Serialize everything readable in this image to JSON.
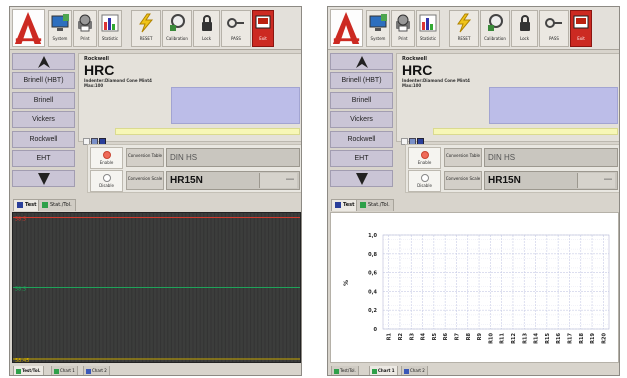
{
  "colors": {
    "toolbar_bg": "#e3e0da",
    "sidebar_button": "#cac5d6",
    "accent_red": "#cc2a22",
    "plot_dark_bg": "#3c3d3c",
    "limit_line": "#d23a2e",
    "target_line": "#1fa35a",
    "low_line": "#c9a800",
    "info_box": "#bcbde8",
    "info_strip": "#f7f7b6",
    "grid_line": "#c8cce6"
  },
  "toolbar": {
    "buttons": [
      {
        "label": "System",
        "icon": "monitor-icon"
      },
      {
        "label": "Print",
        "icon": "printer-icon"
      },
      {
        "label": "Statistic",
        "icon": "bar-chart-icon"
      },
      {
        "label": "RESET",
        "icon": "lightning-icon"
      },
      {
        "label": "Calibration",
        "icon": "calibration-icon"
      },
      {
        "label": "Lock",
        "icon": "lock-icon"
      },
      {
        "label": "PASS",
        "icon": "key-icon"
      },
      {
        "label": "Exit",
        "icon": "exit-icon"
      }
    ]
  },
  "sidebar": {
    "items": [
      "Brinell (HBT)",
      "Brinell",
      "Vickers",
      "Rockwell",
      "EHT"
    ]
  },
  "info": {
    "method": "Rockwell",
    "scale": "HRC",
    "details_line1": "Indenter:Diamond Cone Mint4",
    "details_line2": "Max:100"
  },
  "controls": {
    "enable_label": "Enable",
    "disable_label": "Disable",
    "conversion_table_label": "Conversion Table",
    "conversion_table_value": "DIN HS",
    "conversion_scale_label": "Conversion Scale",
    "conversion_scale_value": "HR15N",
    "dropdown_value": "----"
  },
  "tabs": {
    "test": "Test",
    "stat": "Stat./Tol."
  },
  "bottom_tabs": {
    "test_tol": "Test/Tol.",
    "chart1": "Chart 1",
    "chart2": "Chart 2"
  },
  "left_plot": {
    "upper_label": "58.5",
    "target_label": "58.5",
    "lower_label": "58.45",
    "levels_fraction": {
      "upper": 0.97,
      "target": 0.5,
      "lower": 0.02
    }
  },
  "chart_data": {
    "type": "scatter",
    "title": "",
    "xlabel": "",
    "ylabel": "%",
    "categories": [
      "R1",
      "R2",
      "R3",
      "R4",
      "R5",
      "R6",
      "R7",
      "R8",
      "R9",
      "R10",
      "R11",
      "R12",
      "R13",
      "R14",
      "R15",
      "R16",
      "R17",
      "R18",
      "R19",
      "R20"
    ],
    "yticks": [
      "1,0",
      "0,8",
      "0,6",
      "0,4",
      "0,2",
      "0"
    ],
    "ylim": [
      0,
      1.0
    ],
    "series": [],
    "grid": true
  }
}
